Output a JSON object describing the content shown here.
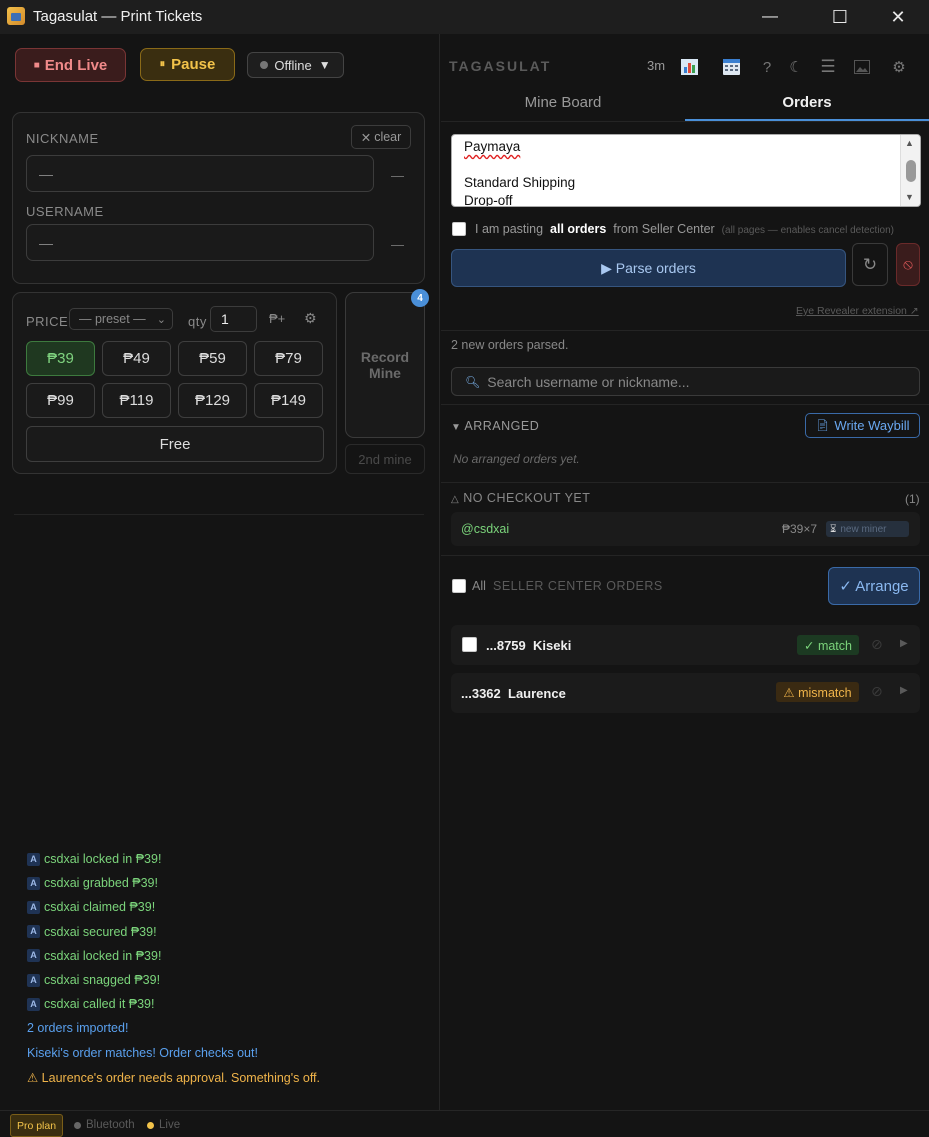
{
  "window": {
    "title": "Tagasulat — Print Tickets",
    "minimize": "—",
    "maximize": "☐",
    "close": "✕"
  },
  "toolbar": {
    "end_live": "End Live",
    "pause": "Pause",
    "connection": "Offline"
  },
  "identity": {
    "nickname_label": "NICKNAME",
    "clear_label": "clear",
    "nickname_placeholder": "—",
    "nickname_status": "—",
    "username_label": "USERNAME",
    "username_placeholder": "—",
    "username_status": "—"
  },
  "price": {
    "label": "PRICE",
    "preset_placeholder": "— preset —",
    "qty_label": "qty",
    "qty_value": "1",
    "peso_plus": "₱+",
    "buttons": [
      "₱39",
      "₱49",
      "₱59",
      "₱79",
      "₱99",
      "₱119",
      "₱129",
      "₱149"
    ],
    "selected": "₱39",
    "free_label": "Free"
  },
  "record": {
    "label_line1": "Record",
    "label_line2": "Mine",
    "badge": "4",
    "second_mine": "2nd mine"
  },
  "log": [
    {
      "text": "csdxai locked in ₱39!",
      "kind": "green",
      "badge": "A"
    },
    {
      "text": "csdxai grabbed ₱39!",
      "kind": "green",
      "badge": "A"
    },
    {
      "text": "csdxai claimed ₱39!",
      "kind": "green",
      "badge": "A"
    },
    {
      "text": "csdxai secured ₱39!",
      "kind": "green",
      "badge": "A"
    },
    {
      "text": "csdxai locked in ₱39!",
      "kind": "green",
      "badge": "A"
    },
    {
      "text": "csdxai snagged ₱39!",
      "kind": "green",
      "badge": "A"
    },
    {
      "text": "csdxai called it ₱39!",
      "kind": "green",
      "badge": "A"
    },
    {
      "text": "2 orders imported!",
      "kind": "blue"
    },
    {
      "text": "Kiseki's order matches! Order checks out!",
      "kind": "blue"
    },
    {
      "text": "⚠ Laurence's order needs approval. Something's off.",
      "kind": "orange"
    }
  ],
  "status_bar": {
    "plan": "Pro plan",
    "bluetooth": "Bluetooth",
    "live": "Live"
  },
  "right_header": {
    "brand": "TAGASULAT",
    "timer": "3m"
  },
  "tabs": [
    {
      "label": "Mine Board",
      "active": false
    },
    {
      "label": "Orders",
      "active": true
    }
  ],
  "paste": {
    "lines": [
      "Paymaya",
      "",
      "Standard Shipping",
      "Drop-off"
    ],
    "all_orders_prefix": "I am pasting",
    "all_orders_bold": "all orders",
    "all_orders_suffix": "from Seller Center",
    "all_orders_hint": "(all pages — enables cancel detection)",
    "parse_button": "▶ Parse orders",
    "extension_link": "Eye Revealer extension ↗"
  },
  "parse_result": "2 new orders parsed.",
  "search": {
    "placeholder": "Search username or nickname..."
  },
  "arranged": {
    "title": "ARRANGED",
    "write_waybill": "Write Waybill",
    "empty": "No arranged orders yet."
  },
  "no_checkout": {
    "title": "NO CHECKOUT YET",
    "count": "(1)",
    "user": "@csdxai",
    "amount": "₱39×7",
    "tag": "new miner"
  },
  "seller_center": {
    "all_label": "All",
    "title": "SELLER CENTER ORDERS",
    "arrange_button": "✓ Arrange",
    "orders": [
      {
        "id": "...8759",
        "name": "Kiseki",
        "status": "✓ match",
        "status_kind": "match"
      },
      {
        "id": "...3362",
        "name": "Laurence",
        "status": "⚠ mismatch",
        "status_kind": "mismatch"
      }
    ]
  },
  "colors": {
    "accent": "#4a8fd8",
    "green": "#7bd47b",
    "orange": "#f0b44a",
    "red": "#f08a8a"
  }
}
